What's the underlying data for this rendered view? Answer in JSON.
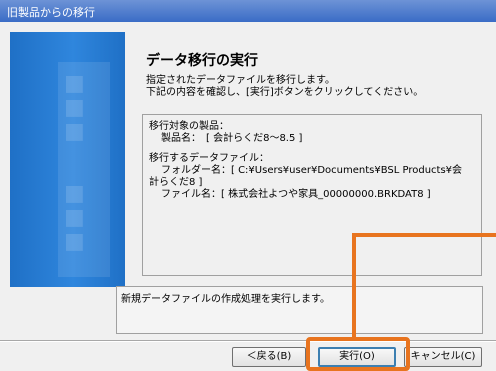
{
  "window": {
    "title": "旧製品からの移行"
  },
  "page": {
    "heading": "データ移行の実行",
    "desc_lines": [
      "指定されたデータファイルを移行します。",
      "下記の内容を確認し、[実行]ボタンをクリックしてください。"
    ]
  },
  "summary": {
    "target_label": "移行対象の製品：",
    "product_line": "製品名：　[ 会計らくだ8～8.5 ]",
    "files_label": "移行するデータファイル：",
    "folder_line": "フォルダー名：[ C:¥Users¥user¥Documents¥BSL Products¥会",
    "folder_line_cont": "計らくだ8 ]",
    "file_line": "ファイル名：[ 株式会社よつや家具_00000000.BRKDAT8 ]"
  },
  "status_message": "新規データファイルの作成処理を実行します。",
  "buttons": {
    "back": "＜戻る(B)",
    "run": "実行(O)",
    "cancel": "キャンセル(C)"
  },
  "colors": {
    "title_bar": "#3a6cc6",
    "sidebar": "#2f86dd",
    "highlight": "#e8741f"
  }
}
